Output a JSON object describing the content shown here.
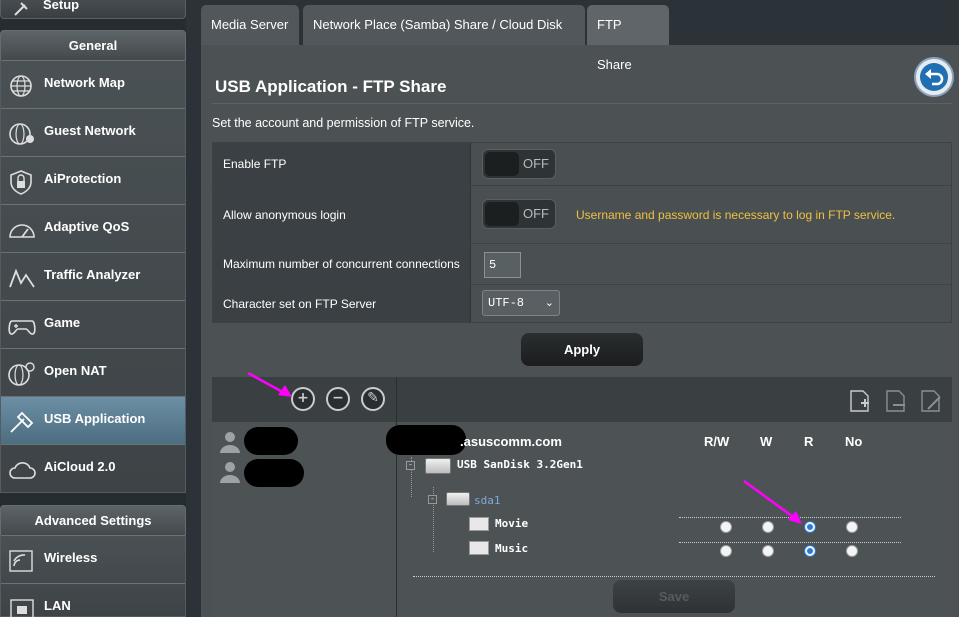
{
  "sidebar": {
    "top_item": {
      "label": "Setup",
      "icon": "setup-icon"
    },
    "general_header": "General",
    "items": [
      {
        "label": "Network Map",
        "icon": "network-map-icon"
      },
      {
        "label": "Guest Network",
        "icon": "guest-network-icon"
      },
      {
        "label": "AiProtection",
        "icon": "shield-lock-icon"
      },
      {
        "label": "Adaptive QoS",
        "icon": "speedometer-icon"
      },
      {
        "label": "Traffic Analyzer",
        "icon": "traffic-analyzer-icon"
      },
      {
        "label": "Game",
        "icon": "gamepad-icon"
      },
      {
        "label": "Open NAT",
        "icon": "open-nat-icon"
      },
      {
        "label": "USB Application",
        "icon": "usb-application-icon",
        "active": true
      },
      {
        "label": "AiCloud 2.0",
        "icon": "cloud-icon"
      }
    ],
    "advanced_header": "Advanced Settings",
    "advanced_items": [
      {
        "label": "Wireless",
        "icon": "wireless-icon"
      },
      {
        "label": "LAN",
        "icon": "lan-icon"
      }
    ]
  },
  "tabs": [
    {
      "label": "Media Server"
    },
    {
      "label": "Network Place (Samba) Share / Cloud Disk"
    },
    {
      "label": "FTP Share",
      "active": true
    }
  ],
  "page": {
    "title": "USB Application - FTP Share",
    "description": "Set the account and permission of FTP service."
  },
  "form": {
    "enable_ftp_label": "Enable FTP",
    "enable_ftp_state": "OFF",
    "anon_label": "Allow anonymous login",
    "anon_state": "OFF",
    "anon_warning": "Username and password is necessary to log in FTP service.",
    "max_conn_label": "Maximum number of concurrent connections",
    "max_conn_value": "5",
    "charset_label": "Character set on FTP Server",
    "charset_value": "UTF-8"
  },
  "apply_label": "Apply",
  "accounts": {
    "host_suffix": ".asuscomm.com",
    "columns": [
      "R/W",
      "W",
      "R",
      "No"
    ],
    "drive_label": "USB SanDisk 3.2Gen1",
    "partition_label": "sda1",
    "folders": [
      {
        "name": "Movie",
        "permission": "R"
      },
      {
        "name": "Music",
        "permission": "R"
      }
    ],
    "save_label": "Save"
  },
  "colors": {
    "warning": "#f0c040",
    "annotation_arrow": "#ff00ff",
    "active_nav": "#5b7d92"
  }
}
